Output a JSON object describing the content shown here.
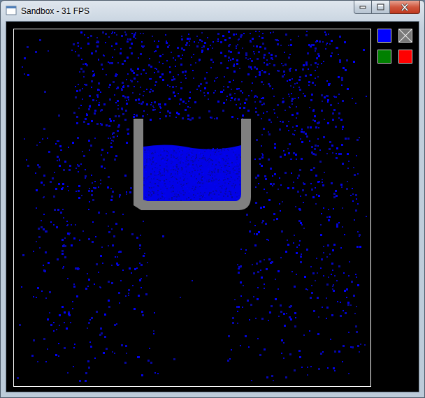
{
  "window": {
    "title": "Sandbox - 31 FPS"
  },
  "tools": [
    {
      "kind": "color",
      "color": "#0000ff"
    },
    {
      "kind": "eraser"
    },
    {
      "kind": "color",
      "color": "#008000"
    },
    {
      "kind": "color",
      "color": "#ff0000"
    }
  ]
}
